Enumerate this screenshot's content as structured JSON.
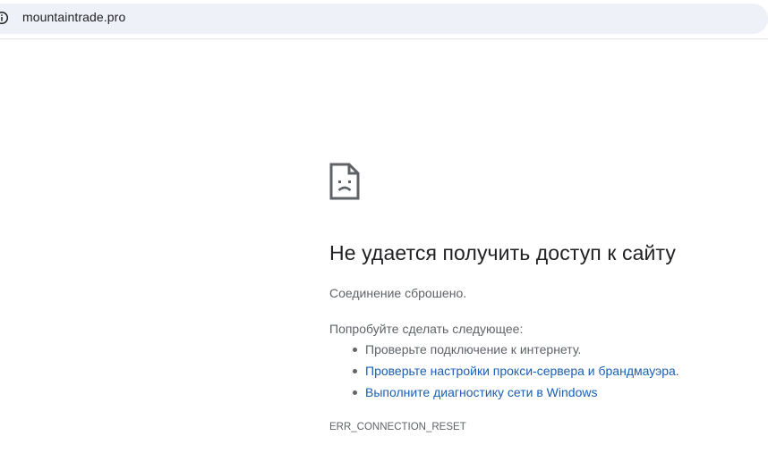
{
  "address_bar": {
    "url": "mountaintrade.pro",
    "site_info_icon": "info-circle-icon"
  },
  "error_page": {
    "icon": "sad-page-icon",
    "title": "Не удается получить доступ к сайту",
    "subtitle": "Соединение сброшено.",
    "suggestions_heading": "Попробуйте сделать следующее:",
    "suggestions": [
      {
        "text": "Проверьте подключение к интернету.",
        "is_link": false
      },
      {
        "text": "Проверьте настройки прокси-сервера и брандмауэра.",
        "is_link": true
      },
      {
        "text": "Выполните диагностику сети в Windows",
        "is_link": true
      }
    ],
    "error_code": "ERR_CONNECTION_RESET"
  },
  "colors": {
    "omnibox_bg": "#eef1f8",
    "title_text": "#202124",
    "body_text": "#5f6368",
    "link": "#1967d2"
  }
}
